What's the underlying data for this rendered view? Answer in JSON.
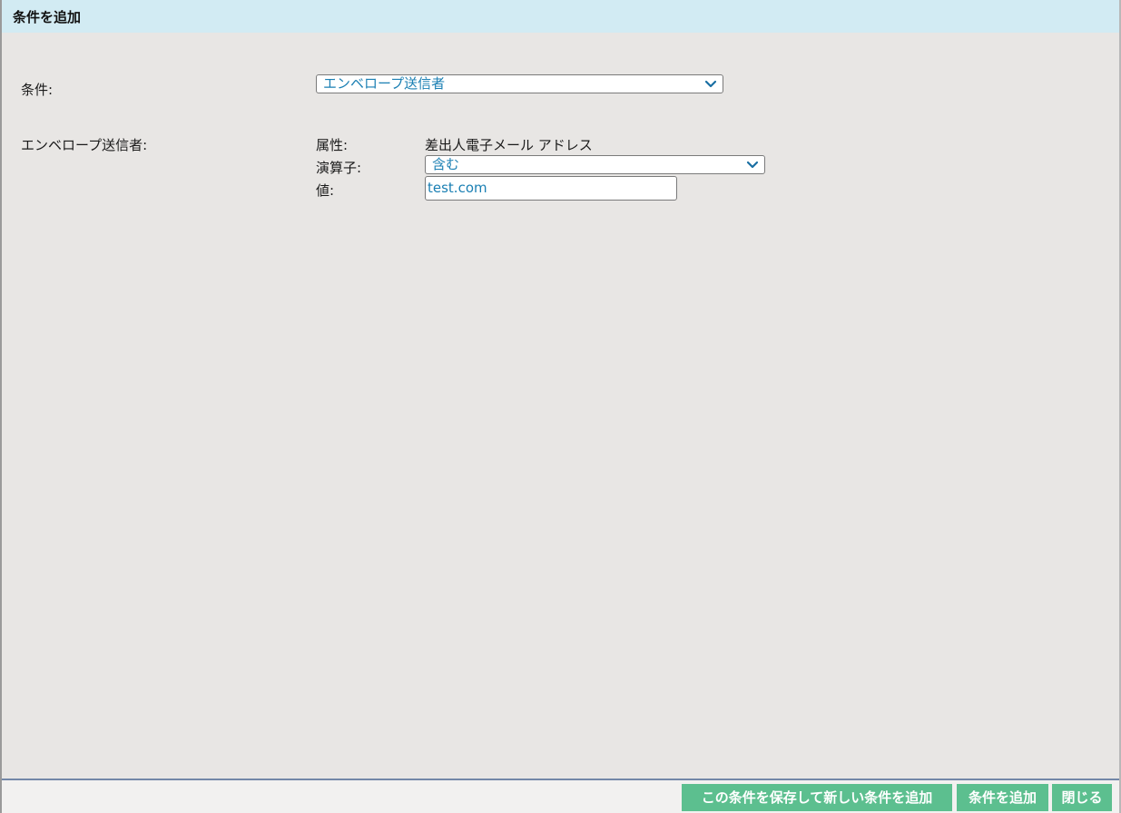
{
  "dialog": {
    "title": "条件を追加"
  },
  "condition": {
    "label": "条件:",
    "selected": "エンベロープ送信者"
  },
  "envelope_sender": {
    "section_label": "エンベロープ送信者:",
    "attribute_label": "属性:",
    "attribute_value": "差出人電子メール アドレス",
    "operator_label": "演算子:",
    "operator_selected": "含む",
    "value_label": "値:",
    "value": "test.com"
  },
  "footer": {
    "save_and_add_new_label": "この条件を保存して新しい条件を追加",
    "add_condition_label": "条件を追加",
    "close_label": "閉じる"
  },
  "colors": {
    "titlebar": "#d2ebf3",
    "dialog_background": "#e8e6e4",
    "select_text": "#1a7fb3",
    "button": "#5cbf8f",
    "footer_separator": "#7387a8"
  },
  "icons": {
    "select_arrow": "chevron-down-icon"
  }
}
